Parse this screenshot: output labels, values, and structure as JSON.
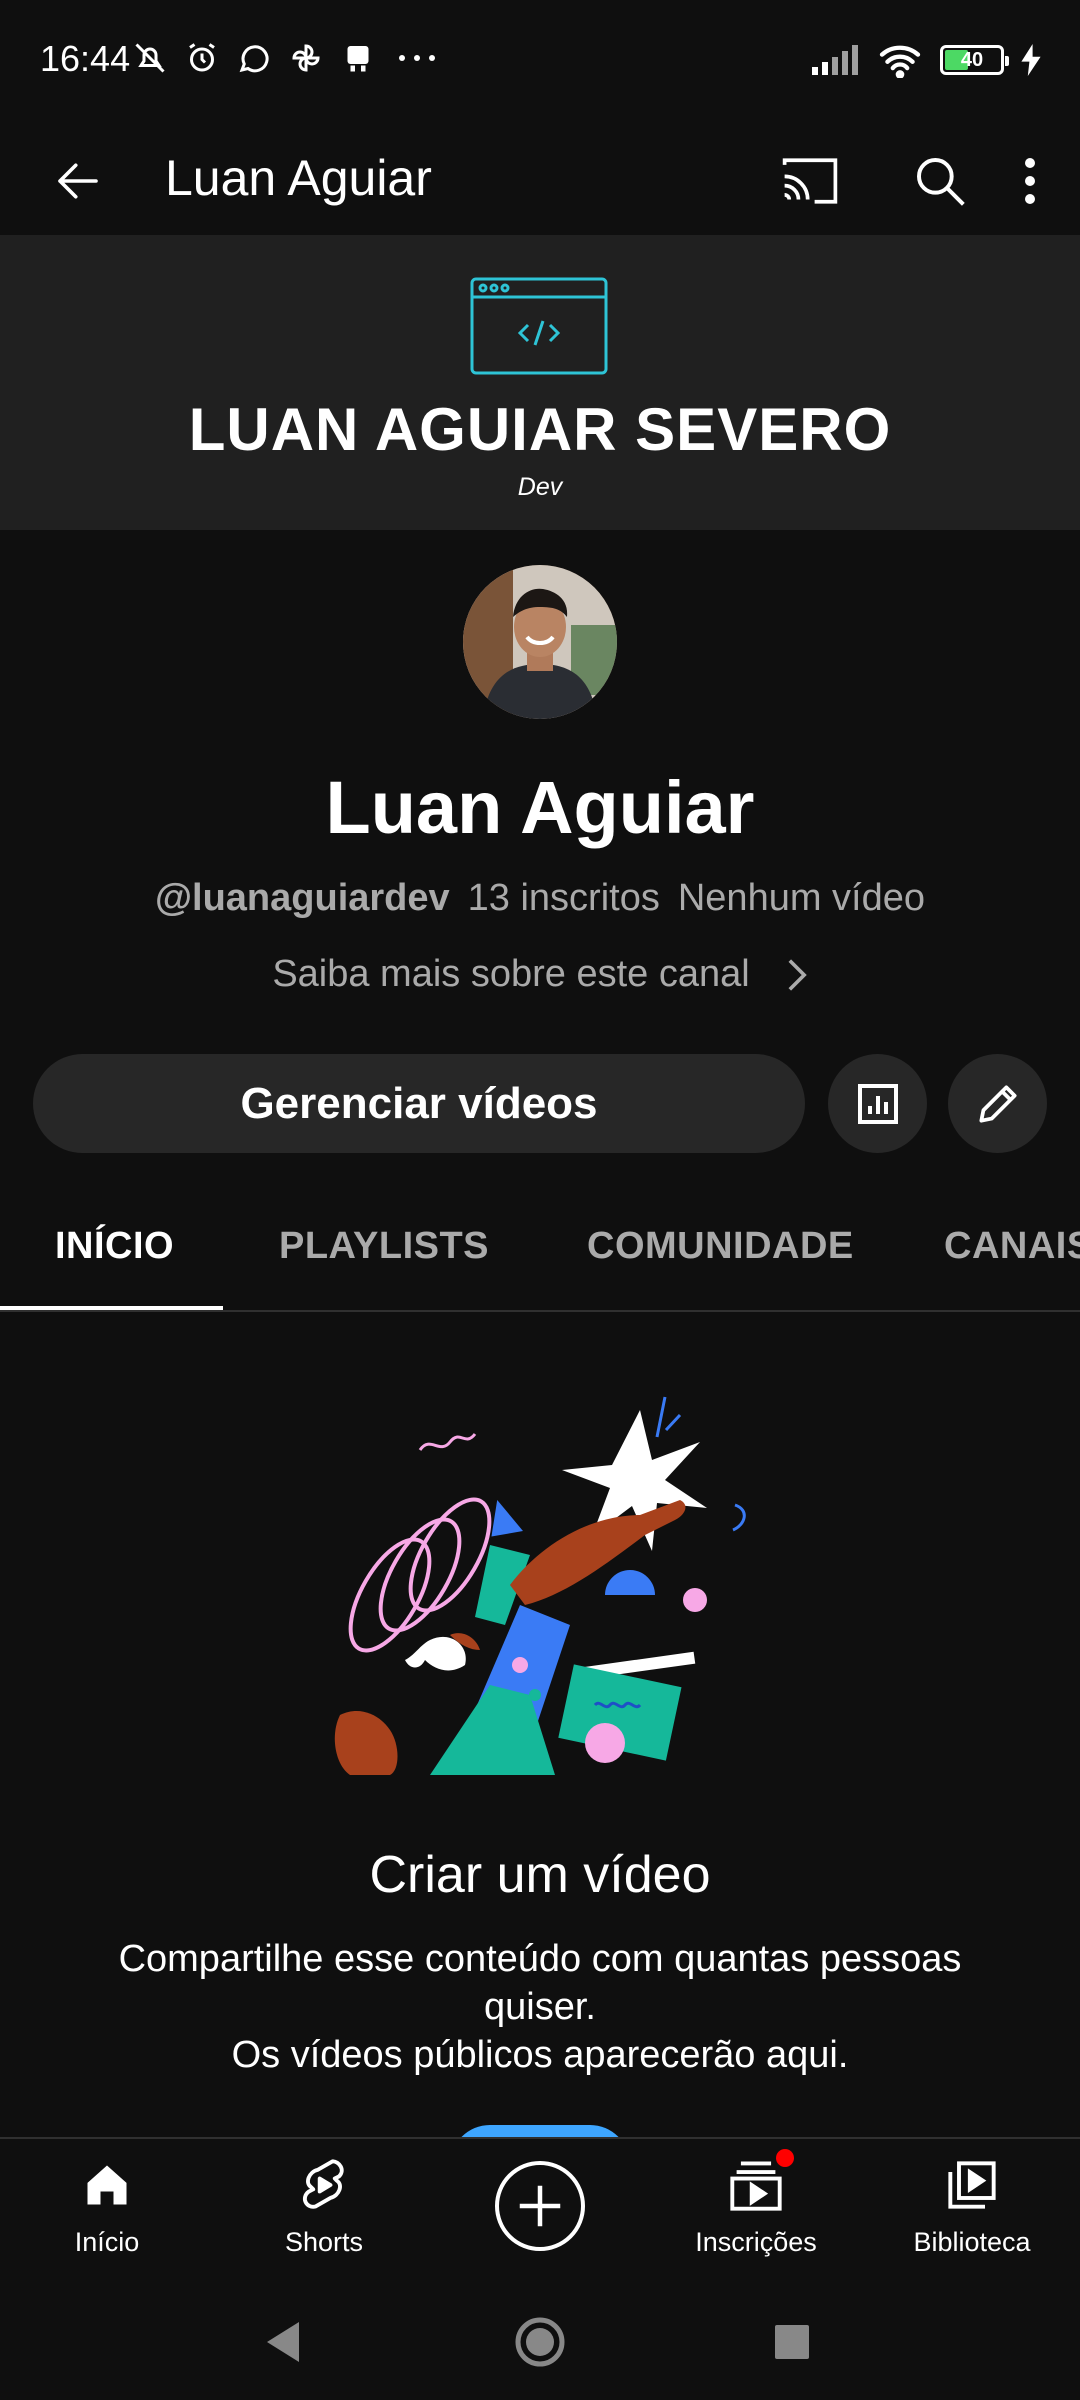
{
  "status_bar": {
    "time": "16:44",
    "left_icons": [
      "mute-icon",
      "alarm-icon",
      "whatsapp-icon",
      "pinwheel-icon",
      "delivery-icon",
      "more-dots-icon"
    ],
    "right_icons": [
      "signal-icon",
      "wifi-icon",
      "battery-icon",
      "charging-icon"
    ],
    "battery_level": "40"
  },
  "app_bar": {
    "title": "Luan Aguiar",
    "actions": [
      "cast-icon",
      "search-icon",
      "more-vert-icon"
    ]
  },
  "banner": {
    "title": "LUAN AGUIAR SEVERO",
    "subtitle": "Dev"
  },
  "channel": {
    "name": "Luan Aguiar",
    "handle": "@luanaguiardev",
    "subscribers": "13 inscritos",
    "videos": "Nenhum vídeo",
    "about_link": "Saiba mais sobre este canal"
  },
  "actions": {
    "manage_label": "Gerenciar vídeos"
  },
  "tabs": [
    {
      "label": "INÍCIO",
      "active": true
    },
    {
      "label": "PLAYLISTS",
      "active": false
    },
    {
      "label": "COMUNIDADE",
      "active": false
    },
    {
      "label": "CANAIS",
      "active": false
    }
  ],
  "empty_state": {
    "title": "Criar um vídeo",
    "line1": "Compartilhe esse conteúdo com quantas pessoas quiser.",
    "line2": "Os vídeos públicos aparecerão aqui."
  },
  "bottom_nav": [
    {
      "label": "Início",
      "icon": "home-icon"
    },
    {
      "label": "Shorts",
      "icon": "shorts-icon"
    },
    {
      "label": "",
      "icon": "create-icon"
    },
    {
      "label": "Inscrições",
      "icon": "subscriptions-icon"
    },
    {
      "label": "Biblioteca",
      "icon": "library-icon"
    }
  ],
  "colors": {
    "background": "#0f0f0f",
    "surface": "#272727",
    "banner": "#202020",
    "accent_teal": "#2ec4d6",
    "notification": "#ff0000",
    "create_button": "#3ea6ff"
  }
}
